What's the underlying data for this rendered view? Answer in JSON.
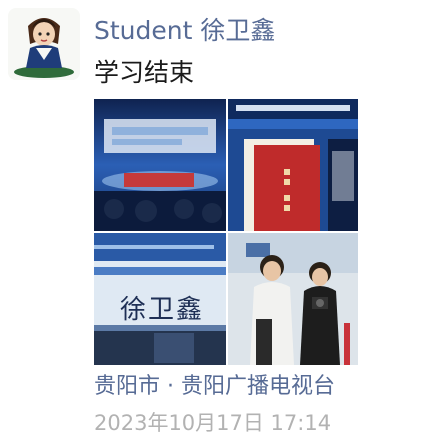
{
  "moment": {
    "author_name": "Student 徐卫鑫",
    "text": "学习结束",
    "location": "贵阳市 · 贵阳广播电视台",
    "timestamp": "2023年10月17日 17:14",
    "photo_overlay_text": "徐卫鑫",
    "photos": [
      {
        "subject": "stage-screen-photo"
      },
      {
        "subject": "conference-booklet-photo"
      },
      {
        "subject": "name-board-photo"
      },
      {
        "subject": "people-with-camera-photo"
      }
    ]
  },
  "colors": {
    "name": "#576b95",
    "text": "#1b1b1b",
    "timestamp": "#b2b2b2",
    "stage_blue": "#1d3d78"
  }
}
